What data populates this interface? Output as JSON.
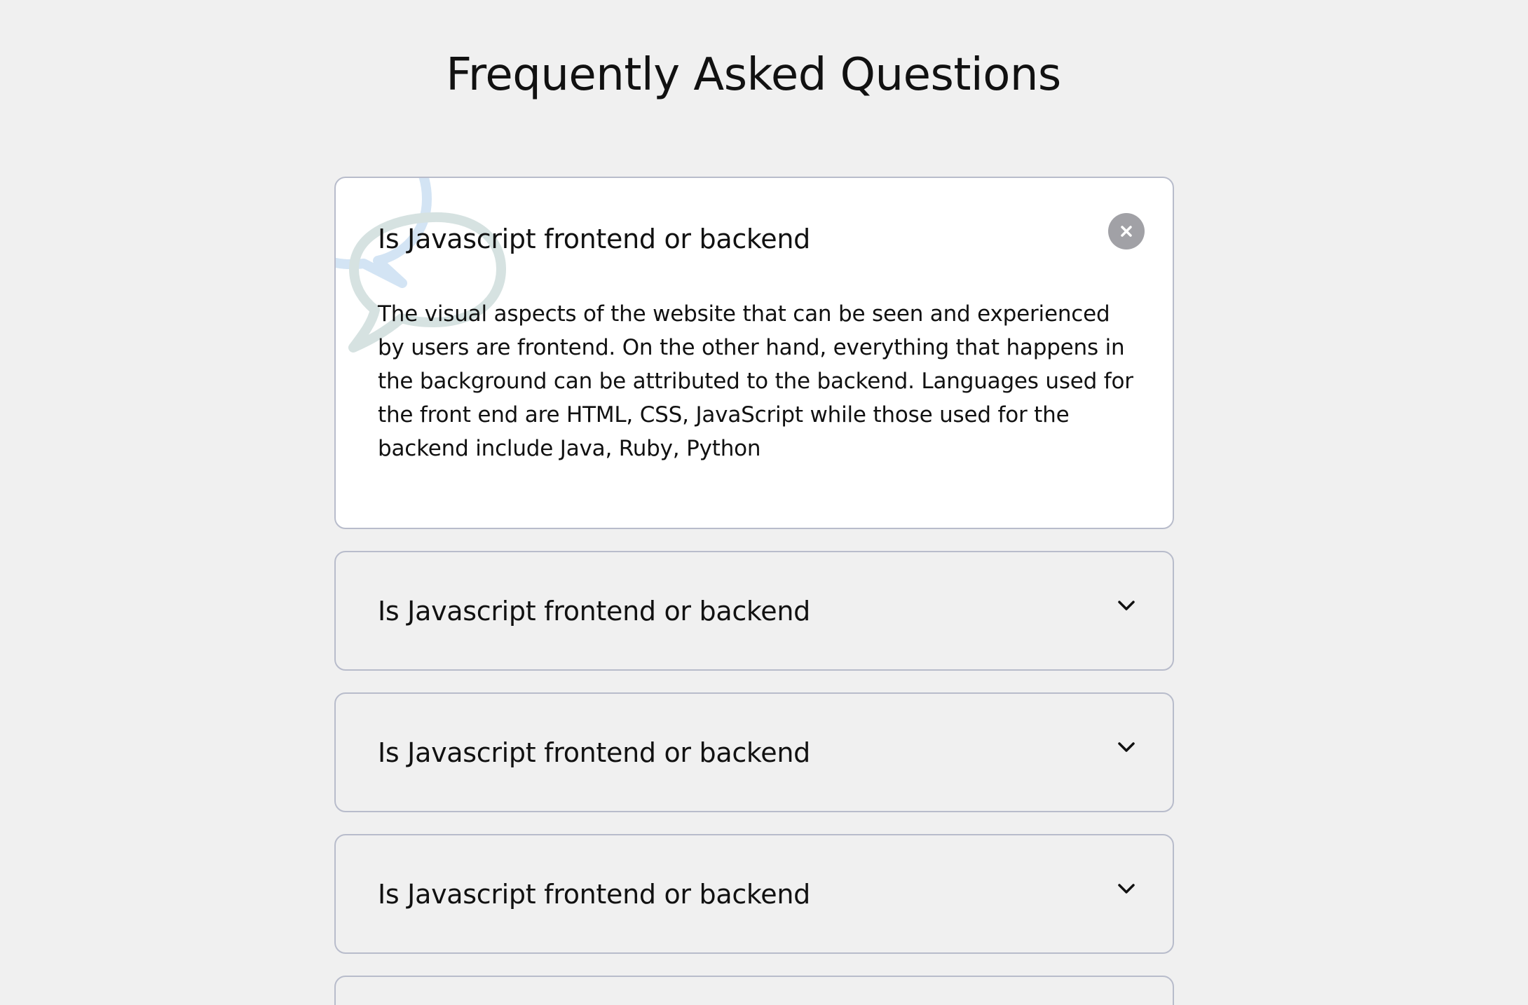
{
  "page": {
    "title": "Frequently Asked Questions"
  },
  "faq": {
    "items": [
      {
        "question": "Is Javascript frontend or backend",
        "answer": "The visual aspects of the website that can be seen and experienced by users are frontend. On the other hand, everything that happens in the background can be attributed to the backend. Languages used for the front end are HTML, CSS, JavaScript while those used for the backend include Java, Ruby, Python",
        "state": "expanded",
        "toggle_icon": "close-icon"
      },
      {
        "question": "Is Javascript frontend or backend",
        "state": "collapsed",
        "toggle_icon": "chevron-down-icon"
      },
      {
        "question": "Is Javascript frontend or backend",
        "state": "collapsed",
        "toggle_icon": "chevron-down-icon"
      },
      {
        "question": "Is Javascript frontend or backend",
        "state": "collapsed",
        "toggle_icon": "chevron-down-icon"
      }
    ]
  },
  "decor": {
    "icon": "speech-bubbles-icon"
  },
  "colors": {
    "background": "#f0f0f0",
    "card_active": "#ffffff",
    "card_border": "#b8bccb",
    "close_button": "#a1a1a6",
    "bubble_blue": "#d3e4f4",
    "bubble_teal": "#d6e2e1",
    "text": "#111111"
  }
}
